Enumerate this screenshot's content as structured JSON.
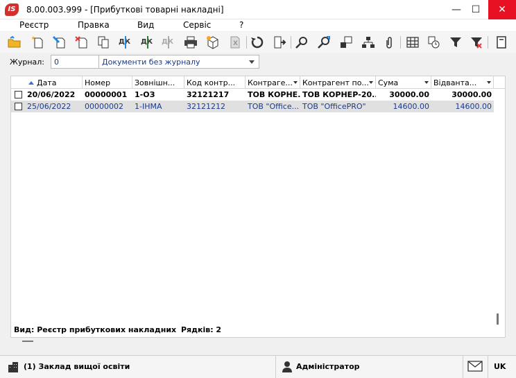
{
  "window": {
    "title": "8.00.003.999 - [Прибуткові товарні накладні]",
    "logo_text": "IS",
    "minimize_glyph": "—",
    "maximize_glyph": "☐",
    "close_glyph": "✕"
  },
  "menu": {
    "items": [
      {
        "label": "Реєстр"
      },
      {
        "label": "Правка"
      },
      {
        "label": "Вид"
      },
      {
        "label": "Сервіс"
      },
      {
        "label": "?"
      }
    ]
  },
  "toolbar": {
    "buttons": [
      {
        "icon": "open-folder-icon"
      },
      {
        "icon": "new-document-icon"
      },
      {
        "icon": "edit-document-icon"
      },
      {
        "icon": "delete-document-icon"
      },
      {
        "icon": "copy-document-icon"
      },
      {
        "icon": "debit-credit-icon",
        "text": "ДК"
      },
      {
        "icon": "debit-credit-green-icon",
        "text": "ДК"
      },
      {
        "icon": "debit-credit-disabled-icon",
        "text": "ДК"
      },
      {
        "icon": "print-icon"
      },
      {
        "icon": "package-icon"
      },
      {
        "icon": "excel-icon"
      },
      {
        "icon": "refresh-icon"
      },
      {
        "icon": "exit-icon"
      },
      {
        "icon": "search-icon"
      },
      {
        "icon": "search-next-icon"
      },
      {
        "icon": "document-link-icon"
      },
      {
        "icon": "hierarchy-icon"
      },
      {
        "icon": "paperclip-icon"
      },
      {
        "icon": "grid-icon"
      },
      {
        "icon": "calendar-clock-icon"
      },
      {
        "icon": "filter-icon"
      },
      {
        "icon": "clear-filter-icon"
      },
      {
        "icon": "panel-icon"
      }
    ]
  },
  "journal": {
    "label": "Журнал:",
    "code": "0",
    "name": "Документи без журналу"
  },
  "grid": {
    "columns": [
      {
        "label": "Дата",
        "sorted": true
      },
      {
        "label": "Номер"
      },
      {
        "label": "Зовнішн..."
      },
      {
        "label": "Код контр..."
      },
      {
        "label": "Контраге..."
      },
      {
        "label": "Контрагент по..."
      },
      {
        "label": "Сума"
      },
      {
        "label": "Відванта..."
      }
    ],
    "rows": [
      {
        "cells": [
          "20/06/2022",
          "00000001",
          "1-ОЗ",
          "32121217",
          "ТОВ КОРНЕ...",
          "ТОВ КОРНЕР-20...",
          "30000.00",
          "30000.00"
        ]
      },
      {
        "cells": [
          "25/06/2022",
          "00000002",
          "1-ІНМА",
          "32121212",
          "ТОВ \"Office...",
          "ТОВ \"OfficePRO\"",
          "14600.00",
          "14600.00"
        ]
      }
    ]
  },
  "status": {
    "view": "Вид: Реєстр прибуткових накладних",
    "rows": "Рядків: 2"
  },
  "bottom": {
    "organization": "(1) Заклад вищої освіти",
    "user": "Адміністратор",
    "language": "UK"
  },
  "colors": {
    "accent": "#1a3a8a",
    "close_button": "#e81123",
    "selected_row": "#e0e0e0"
  }
}
